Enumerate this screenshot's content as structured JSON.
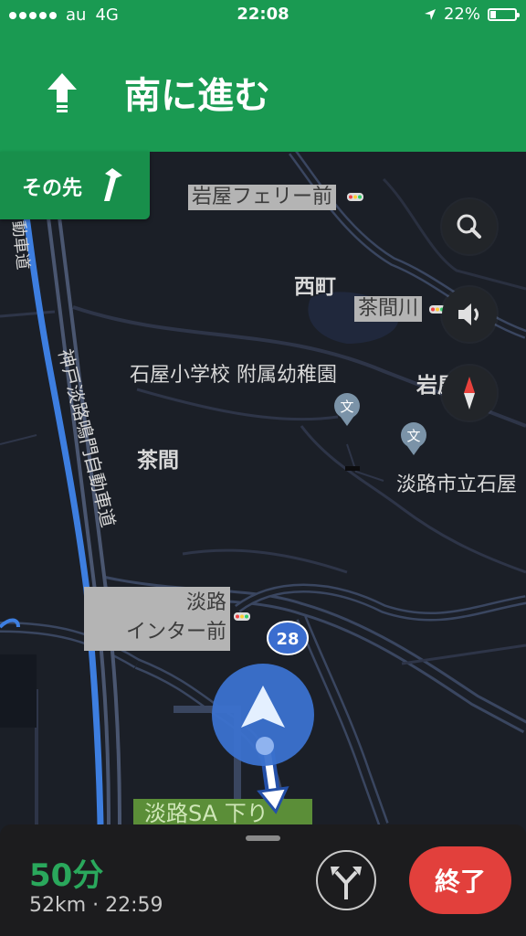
{
  "status_bar": {
    "carrier": "au",
    "network": "4G",
    "time": "22:08",
    "battery_percent": "22%",
    "battery_level": 0.22
  },
  "navigation": {
    "instruction": "南に進む",
    "direction_icon": "arrow-up-icon",
    "then_label": "その先",
    "then_icon": "turn-slight-right-icon"
  },
  "map": {
    "labels": {
      "iwaya_ferry": "岩屋フェリー前",
      "nishimachi": "西町",
      "chama_river": "茶間川",
      "iwaya_school": "石屋小学校 附属幼稚園",
      "iwaya_partial": "岩屋",
      "chama": "茶間",
      "awaji_city": "淡路市立石屋",
      "awaji_ic_line1": "淡路",
      "awaji_ic_line2": "インター前",
      "route_number": "28",
      "expressway": "神戸淡路鳴門自動車道",
      "expressway_top": "動車道",
      "sa": "淡路SA 下り",
      "school_icon_char": "文"
    }
  },
  "controls": {
    "search": "search-icon",
    "sound": "speaker-icon",
    "compass": "compass-icon"
  },
  "bottom": {
    "eta": "50分",
    "details": "52km · 22:59",
    "end_label": "終了"
  },
  "colors": {
    "header_green": "#1a9a52",
    "route_blue": "#3d7ee0",
    "end_red": "#e2403c",
    "eta_green": "#2aa85c"
  }
}
